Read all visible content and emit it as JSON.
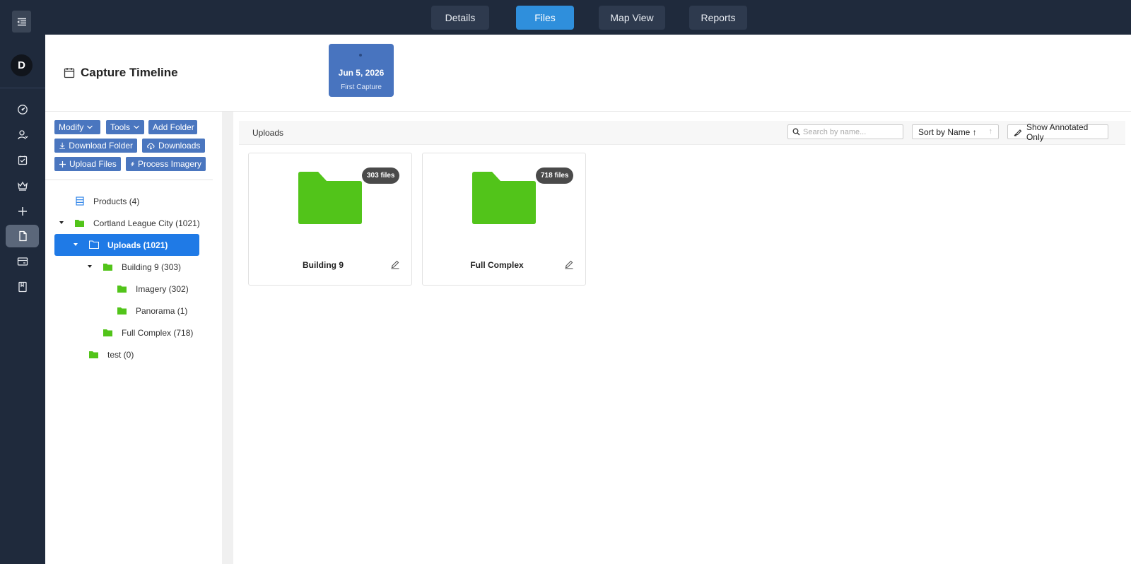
{
  "rail": {
    "avatar_initial": "D",
    "items": [
      {
        "icon": "dashboard-icon"
      },
      {
        "icon": "user-icon"
      },
      {
        "icon": "task-check-icon"
      },
      {
        "icon": "crown-icon"
      },
      {
        "icon": "plus-icon"
      },
      {
        "icon": "file-icon",
        "active": true
      },
      {
        "icon": "card-icon"
      },
      {
        "icon": "book-icon"
      }
    ]
  },
  "topbar": {
    "tabs": [
      {
        "label": "Details"
      },
      {
        "label": "Files",
        "active": true
      },
      {
        "label": "Map View"
      },
      {
        "label": "Reports"
      }
    ]
  },
  "timeline": {
    "title": "Capture Timeline",
    "capture": {
      "date": "Jun 5, 2026",
      "label": "First Capture"
    }
  },
  "toolbar": {
    "modify": "Modify",
    "tools": "Tools",
    "add_folder": "Add Folder",
    "download_folder": "Download Folder",
    "downloads": "Downloads",
    "upload_files": "Upload Files",
    "process_imagery": "Process Imagery"
  },
  "tree": {
    "products": "Products (4)",
    "project": "Cortland League City (1021)",
    "uploads": "Uploads (1021)",
    "building9": "Building 9 (303)",
    "imagery": "Imagery (302)",
    "panorama": "Panorama (1)",
    "full_complex": "Full Complex (718)",
    "test": "test (0)"
  },
  "main": {
    "path": "Uploads",
    "search_placeholder": "Search by name...",
    "sort_label": "Sort by Name ↑",
    "annotated_label": "Show Annotated Only",
    "folders": [
      {
        "name": "Building 9",
        "count": "303 files"
      },
      {
        "name": "Full Complex",
        "count": "718 files"
      }
    ]
  },
  "colors": {
    "folder_green": "#52c41a",
    "primary_blue": "#1f7ae6",
    "active_tab": "#2f8fdc",
    "dark_bg": "#1f2a3c"
  }
}
